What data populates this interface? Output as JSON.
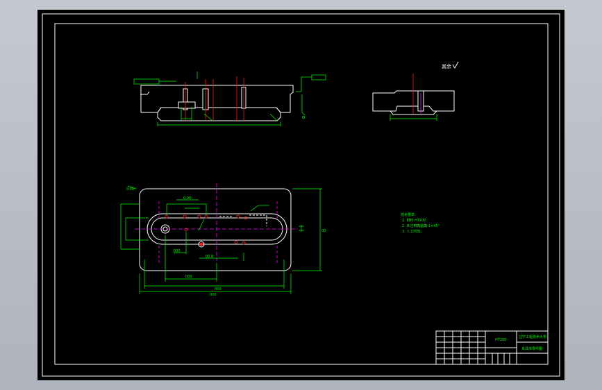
{
  "drawing": {
    "roughness_label": "其余",
    "notes_title": "技术要求:",
    "notes": [
      "1. 材料 HT200",
      "2. 未注倒角圆角 1×45°",
      "3. 人工时效。"
    ],
    "title_block": {
      "school": "辽宁工程技术大学",
      "drawing_name": "夹具体零件图",
      "material": "HT200"
    }
  }
}
